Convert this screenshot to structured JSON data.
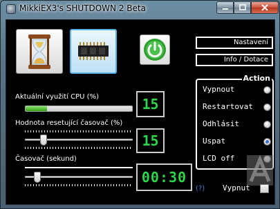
{
  "window": {
    "title": "MikkiEX3's SHUTDOWN 2 Beta"
  },
  "modes": {
    "timer_mode_icon": "hourglass-icon",
    "cpu_mode_icon": "cpu-chip-icon",
    "power_icon": "power-icon"
  },
  "buttons": {
    "settings_label": "Nastavení",
    "info_label": "Info / Dotace"
  },
  "cpu": {
    "label": "Aktuální využití CPU (%)",
    "value": "15",
    "progress_fraction": 0.2
  },
  "reset_timer": {
    "label": "Hodnota resetující časovač (%)",
    "value": "15",
    "slider_fraction": 0.15
  },
  "timer": {
    "label": "Časovač (sekund)",
    "value": "00:30",
    "slider_fraction": 0.09
  },
  "help": {
    "label": "(?)"
  },
  "action": {
    "title": "Action",
    "options": [
      {
        "label": "Vypnout",
        "checked": false
      },
      {
        "label": "Restartovat",
        "checked": false
      },
      {
        "label": "Odhlásit",
        "checked": false
      },
      {
        "label": "Uspat",
        "checked": true
      },
      {
        "label": "LCD off",
        "checked": false
      }
    ]
  },
  "toggle": {
    "label": "Vypnut",
    "checked": false
  },
  "colors": {
    "digital_green": "#2cd64a",
    "progress_green": "#2fa312",
    "selection_blue": "#5ab4e8"
  }
}
